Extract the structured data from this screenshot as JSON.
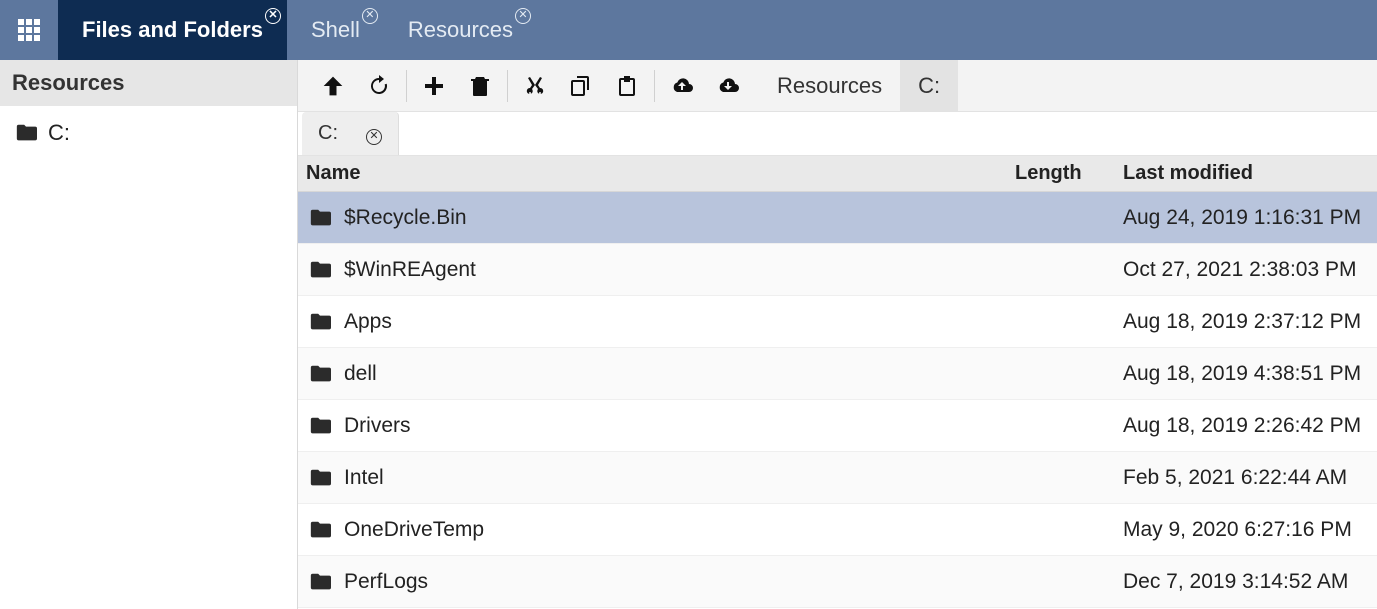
{
  "topbar": {
    "tabs": [
      {
        "label": "Files and Folders",
        "active": true
      },
      {
        "label": "Shell",
        "active": false
      },
      {
        "label": "Resources",
        "active": false
      }
    ]
  },
  "sidebar": {
    "header": "Resources",
    "items": [
      {
        "label": "C:"
      }
    ]
  },
  "breadcrumbs": [
    {
      "label": "Resources"
    },
    {
      "label": "C:"
    }
  ],
  "pathTabs": [
    {
      "label": "C:"
    }
  ],
  "columns": {
    "name": "Name",
    "length": "Length",
    "lastModified": "Last modified"
  },
  "rows": [
    {
      "name": "$Recycle.Bin",
      "length": "",
      "modified": "Aug 24, 2019 1:16:31 PM",
      "selected": true
    },
    {
      "name": "$WinREAgent",
      "length": "",
      "modified": "Oct 27, 2021 2:38:03 PM"
    },
    {
      "name": "Apps",
      "length": "",
      "modified": "Aug 18, 2019 2:37:12 PM"
    },
    {
      "name": "dell",
      "length": "",
      "modified": "Aug 18, 2019 4:38:51 PM"
    },
    {
      "name": "Drivers",
      "length": "",
      "modified": "Aug 18, 2019 2:26:42 PM"
    },
    {
      "name": "Intel",
      "length": "",
      "modified": "Feb 5, 2021 6:22:44 AM"
    },
    {
      "name": "OneDriveTemp",
      "length": "",
      "modified": "May 9, 2020 6:27:16 PM"
    },
    {
      "name": "PerfLogs",
      "length": "",
      "modified": "Dec 7, 2019 3:14:52 AM"
    }
  ]
}
